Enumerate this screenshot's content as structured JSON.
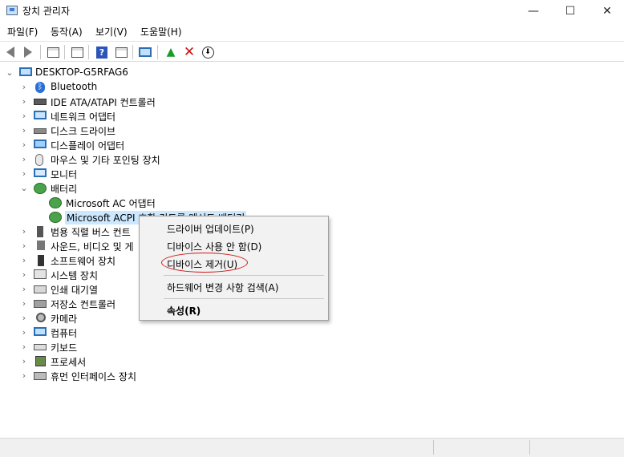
{
  "window": {
    "title": "장치 관리자",
    "min_glyph": "—",
    "max_glyph": "☐",
    "close_glyph": "✕"
  },
  "menu": [
    "파일(F)",
    "동작(A)",
    "보기(V)",
    "도움말(H)"
  ],
  "toolbar": {
    "icons": [
      "back-icon",
      "forward-icon",
      "properties-grid-icon",
      "list-grid-icon",
      "help-icon",
      "view-grid-icon",
      "monitor-icon",
      "add-driver-icon",
      "uninstall-x-icon",
      "download-icon"
    ],
    "help_glyph": "?",
    "add_glyph": "▲",
    "x_glyph": "✕",
    "down_glyph": "⬇"
  },
  "tree": {
    "root": "DESKTOP-G5RFAG6",
    "root_chevron": "⌄",
    "collapsed_chevron": "›",
    "expanded_chevron": "⌄",
    "bt_glyph": "ᛒ",
    "categories": [
      "Bluetooth",
      "IDE ATA/ATAPI 컨트롤러",
      "네트워크 어댑터",
      "디스크 드라이브",
      "디스플레이 어댑터",
      "마우스 및 기타 포인팅 장치",
      "모니터",
      "배터리",
      "Microsoft AC 어댑터",
      "Microsoft ACPI 호환 컨트롤 메서드 배터리",
      "범용 직렬 버스 컨트",
      "사운드, 비디오 및 게",
      "소프트웨어 장치",
      "시스템 장치",
      "인쇄 대기열",
      "저장소 컨트롤러",
      "카메라",
      "컴퓨터",
      "키보드",
      "프로세서",
      "휴먼 인터페이스 장치"
    ]
  },
  "context_menu": {
    "items": [
      "드라이버 업데이트(P)",
      "디바이스 사용 안 함(D)",
      "디바이스 제거(U)",
      "하드웨어 변경 사항 검색(A)",
      "속성(R)"
    ],
    "highlight_color": "#d01818"
  },
  "colors": {
    "selection": "#cce8ff",
    "accent": "#2d6fb5"
  }
}
